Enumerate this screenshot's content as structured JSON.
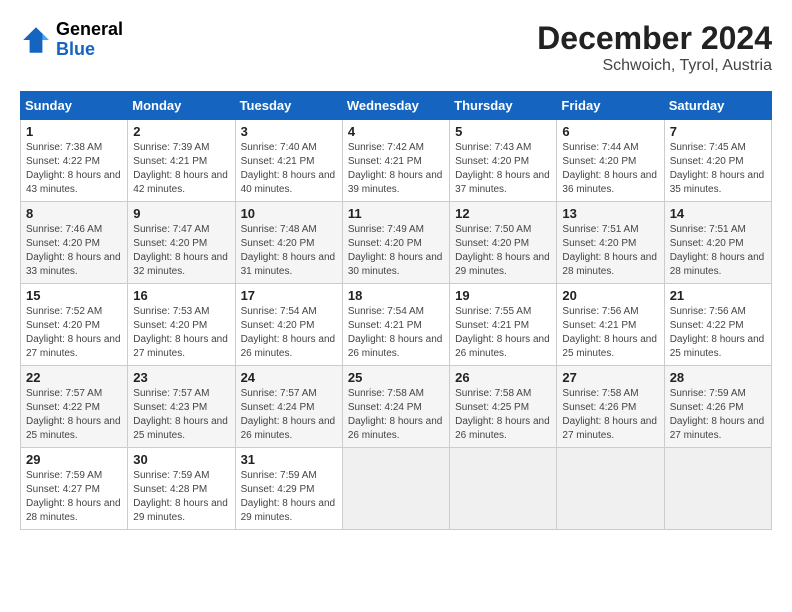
{
  "header": {
    "logo_general": "General",
    "logo_blue": "Blue",
    "title": "December 2024",
    "subtitle": "Schwoich, Tyrol, Austria"
  },
  "days_of_week": [
    "Sunday",
    "Monday",
    "Tuesday",
    "Wednesday",
    "Thursday",
    "Friday",
    "Saturday"
  ],
  "weeks": [
    [
      {
        "day": "1",
        "sunrise": "7:38 AM",
        "sunset": "4:22 PM",
        "daylight": "8 hours and 43 minutes."
      },
      {
        "day": "2",
        "sunrise": "7:39 AM",
        "sunset": "4:21 PM",
        "daylight": "8 hours and 42 minutes."
      },
      {
        "day": "3",
        "sunrise": "7:40 AM",
        "sunset": "4:21 PM",
        "daylight": "8 hours and 40 minutes."
      },
      {
        "day": "4",
        "sunrise": "7:42 AM",
        "sunset": "4:21 PM",
        "daylight": "8 hours and 39 minutes."
      },
      {
        "day": "5",
        "sunrise": "7:43 AM",
        "sunset": "4:20 PM",
        "daylight": "8 hours and 37 minutes."
      },
      {
        "day": "6",
        "sunrise": "7:44 AM",
        "sunset": "4:20 PM",
        "daylight": "8 hours and 36 minutes."
      },
      {
        "day": "7",
        "sunrise": "7:45 AM",
        "sunset": "4:20 PM",
        "daylight": "8 hours and 35 minutes."
      }
    ],
    [
      {
        "day": "8",
        "sunrise": "7:46 AM",
        "sunset": "4:20 PM",
        "daylight": "8 hours and 33 minutes."
      },
      {
        "day": "9",
        "sunrise": "7:47 AM",
        "sunset": "4:20 PM",
        "daylight": "8 hours and 32 minutes."
      },
      {
        "day": "10",
        "sunrise": "7:48 AM",
        "sunset": "4:20 PM",
        "daylight": "8 hours and 31 minutes."
      },
      {
        "day": "11",
        "sunrise": "7:49 AM",
        "sunset": "4:20 PM",
        "daylight": "8 hours and 30 minutes."
      },
      {
        "day": "12",
        "sunrise": "7:50 AM",
        "sunset": "4:20 PM",
        "daylight": "8 hours and 29 minutes."
      },
      {
        "day": "13",
        "sunrise": "7:51 AM",
        "sunset": "4:20 PM",
        "daylight": "8 hours and 28 minutes."
      },
      {
        "day": "14",
        "sunrise": "7:51 AM",
        "sunset": "4:20 PM",
        "daylight": "8 hours and 28 minutes."
      }
    ],
    [
      {
        "day": "15",
        "sunrise": "7:52 AM",
        "sunset": "4:20 PM",
        "daylight": "8 hours and 27 minutes."
      },
      {
        "day": "16",
        "sunrise": "7:53 AM",
        "sunset": "4:20 PM",
        "daylight": "8 hours and 27 minutes."
      },
      {
        "day": "17",
        "sunrise": "7:54 AM",
        "sunset": "4:20 PM",
        "daylight": "8 hours and 26 minutes."
      },
      {
        "day": "18",
        "sunrise": "7:54 AM",
        "sunset": "4:21 PM",
        "daylight": "8 hours and 26 minutes."
      },
      {
        "day": "19",
        "sunrise": "7:55 AM",
        "sunset": "4:21 PM",
        "daylight": "8 hours and 26 minutes."
      },
      {
        "day": "20",
        "sunrise": "7:56 AM",
        "sunset": "4:21 PM",
        "daylight": "8 hours and 25 minutes."
      },
      {
        "day": "21",
        "sunrise": "7:56 AM",
        "sunset": "4:22 PM",
        "daylight": "8 hours and 25 minutes."
      }
    ],
    [
      {
        "day": "22",
        "sunrise": "7:57 AM",
        "sunset": "4:22 PM",
        "daylight": "8 hours and 25 minutes."
      },
      {
        "day": "23",
        "sunrise": "7:57 AM",
        "sunset": "4:23 PM",
        "daylight": "8 hours and 25 minutes."
      },
      {
        "day": "24",
        "sunrise": "7:57 AM",
        "sunset": "4:24 PM",
        "daylight": "8 hours and 26 minutes."
      },
      {
        "day": "25",
        "sunrise": "7:58 AM",
        "sunset": "4:24 PM",
        "daylight": "8 hours and 26 minutes."
      },
      {
        "day": "26",
        "sunrise": "7:58 AM",
        "sunset": "4:25 PM",
        "daylight": "8 hours and 26 minutes."
      },
      {
        "day": "27",
        "sunrise": "7:58 AM",
        "sunset": "4:26 PM",
        "daylight": "8 hours and 27 minutes."
      },
      {
        "day": "28",
        "sunrise": "7:59 AM",
        "sunset": "4:26 PM",
        "daylight": "8 hours and 27 minutes."
      }
    ],
    [
      {
        "day": "29",
        "sunrise": "7:59 AM",
        "sunset": "4:27 PM",
        "daylight": "8 hours and 28 minutes."
      },
      {
        "day": "30",
        "sunrise": "7:59 AM",
        "sunset": "4:28 PM",
        "daylight": "8 hours and 29 minutes."
      },
      {
        "day": "31",
        "sunrise": "7:59 AM",
        "sunset": "4:29 PM",
        "daylight": "8 hours and 29 minutes."
      },
      null,
      null,
      null,
      null
    ]
  ]
}
